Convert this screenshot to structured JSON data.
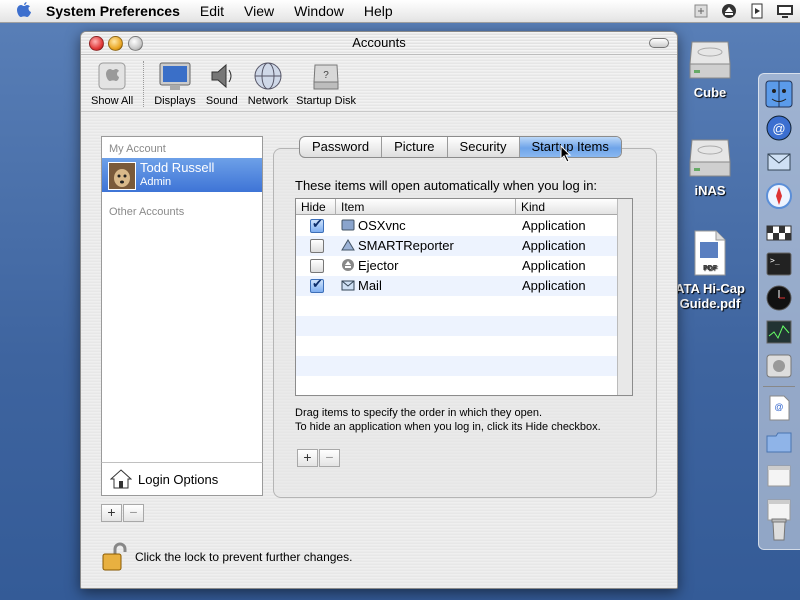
{
  "menubar": {
    "app_name": "System Preferences",
    "items": [
      "Edit",
      "View",
      "Window",
      "Help"
    ]
  },
  "desktop": {
    "icons": [
      {
        "label": "Cube",
        "icon": "hard-drive-icon"
      },
      {
        "label": "iNAS",
        "icon": "hard-drive-icon"
      },
      {
        "label": "ATA Hi-Cap Guide.pdf",
        "icon": "pdf-document-icon",
        "badge": "PDF"
      }
    ]
  },
  "window": {
    "title": "Accounts",
    "toolbar": [
      {
        "label": "Show All",
        "icon": "apple-prefs-icon"
      },
      {
        "label": "Displays",
        "icon": "display-icon"
      },
      {
        "label": "Sound",
        "icon": "speaker-icon"
      },
      {
        "label": "Network",
        "icon": "globe-icon"
      },
      {
        "label": "Startup Disk",
        "icon": "disk-icon"
      }
    ]
  },
  "accounts": {
    "my_account_label": "My Account",
    "current": {
      "name": "Todd Russell",
      "role": "Admin"
    },
    "other_accounts_label": "Other Accounts",
    "login_options_label": "Login Options"
  },
  "tabs": [
    "Password",
    "Picture",
    "Security",
    "Startup Items"
  ],
  "active_tab": "Startup Items",
  "startup": {
    "heading": "These items will open automatically when you log in:",
    "columns": [
      "Hide",
      "Item",
      "Kind"
    ],
    "rows": [
      {
        "hide": true,
        "item": "OSXvnc",
        "kind": "Application"
      },
      {
        "hide": false,
        "item": "SMARTReporter",
        "kind": "Application"
      },
      {
        "hide": false,
        "item": "Ejector",
        "kind": "Application"
      },
      {
        "hide": true,
        "item": "Mail",
        "kind": "Application"
      }
    ],
    "help_line1": "Drag items to specify the order in which they open.",
    "help_line2": "To hide an application when you log in, click its Hide checkbox."
  },
  "controls": {
    "plus": "+",
    "minus": "−"
  },
  "lock_text": "Click the lock to prevent further changes.",
  "colors": {
    "selection": "#3e74d6",
    "desktop": "#4a6fa8"
  }
}
